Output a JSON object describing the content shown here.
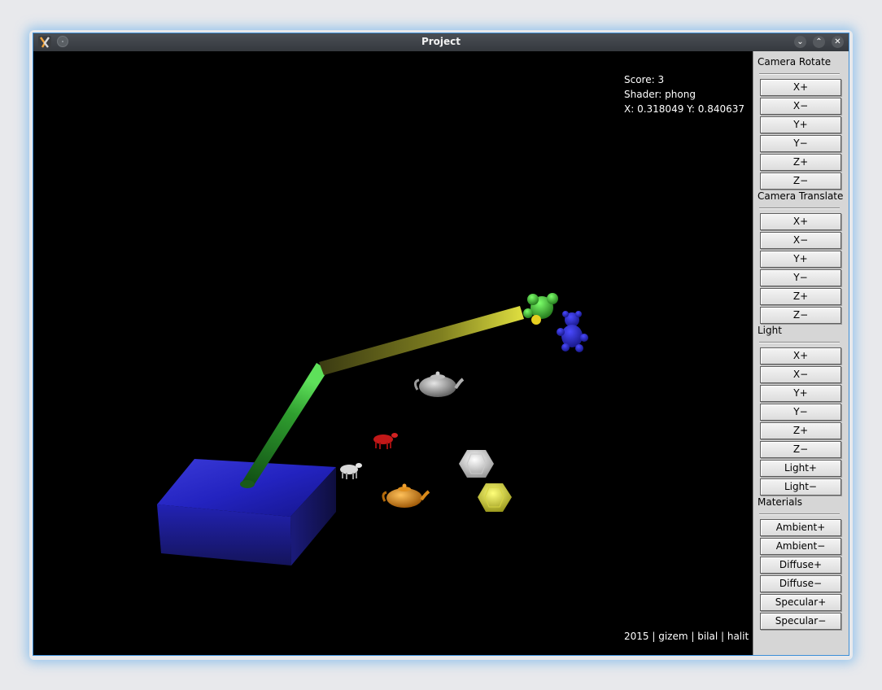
{
  "window": {
    "title": "Project",
    "accent": "#3d8fd8"
  },
  "hud": {
    "score": "Score: 3",
    "shader": "Shader: phong",
    "coords": "X: 0.318049 Y: 0.840637",
    "credits": "2015 | gizem | bilal | halit"
  },
  "panel": {
    "camera_rotate": {
      "title": "Camera Rotate",
      "buttons": [
        "X+",
        "X−",
        "Y+",
        "Y−",
        "Z+",
        "Z−"
      ]
    },
    "camera_translate": {
      "title": "Camera Translate",
      "buttons": [
        "X+",
        "X−",
        "Y+",
        "Y−",
        "Z+",
        "Z−"
      ]
    },
    "light": {
      "title": "Light",
      "buttons": [
        "X+",
        "X−",
        "Y+",
        "Y−",
        "Z+",
        "Z−",
        "Light+",
        "Light−"
      ]
    },
    "materials": {
      "title": "Materials",
      "buttons": [
        "Ambient+",
        "Ambient−",
        "Diffuse+",
        "Diffuse−",
        "Specular+",
        "Specular−"
      ]
    }
  },
  "scene": {
    "objects": [
      "blue-base-block",
      "green-arm-segment",
      "yellow-arm-segment",
      "green-teddy-bear",
      "blue-teddy-bear",
      "gray-teapot",
      "orange-teapot",
      "red-cow",
      "white-cow",
      "white-dodecahedron",
      "yellow-dodecahedron"
    ]
  }
}
